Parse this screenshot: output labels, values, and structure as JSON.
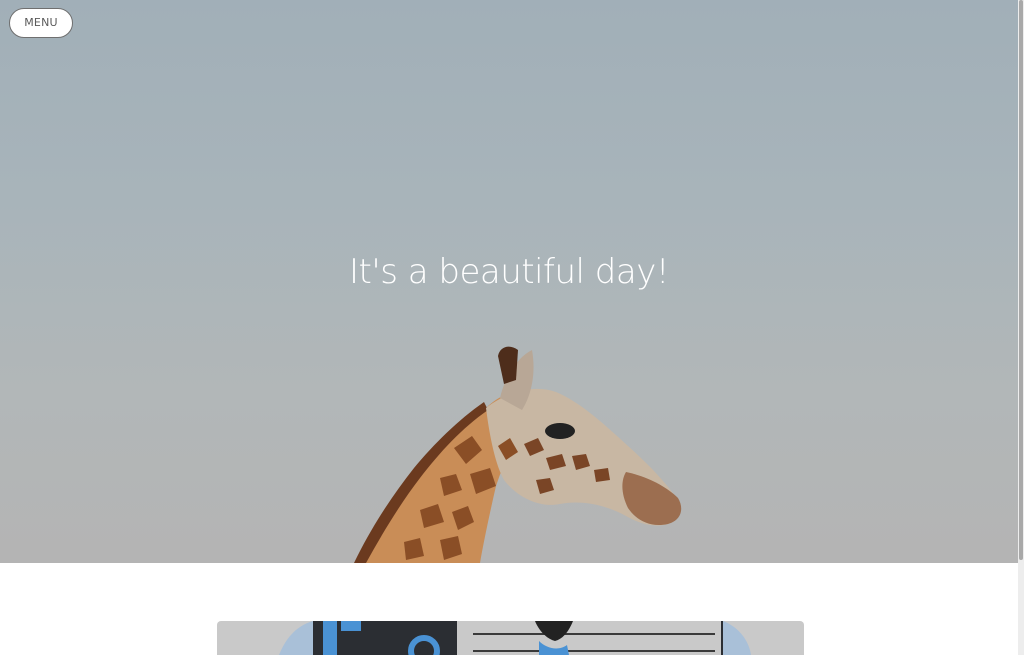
{
  "menu": {
    "label": "MENU"
  },
  "hero": {
    "title": "It's a beautiful day!",
    "image": "giraffe-photo"
  },
  "featured_card": {
    "image": "illustration-thumbnail"
  },
  "colors": {
    "sky_top": "#a1afb8",
    "sky_bottom": "#b4b4b4",
    "illustration_blue": "#4a92d4",
    "illustration_dark": "#2b2e33"
  }
}
